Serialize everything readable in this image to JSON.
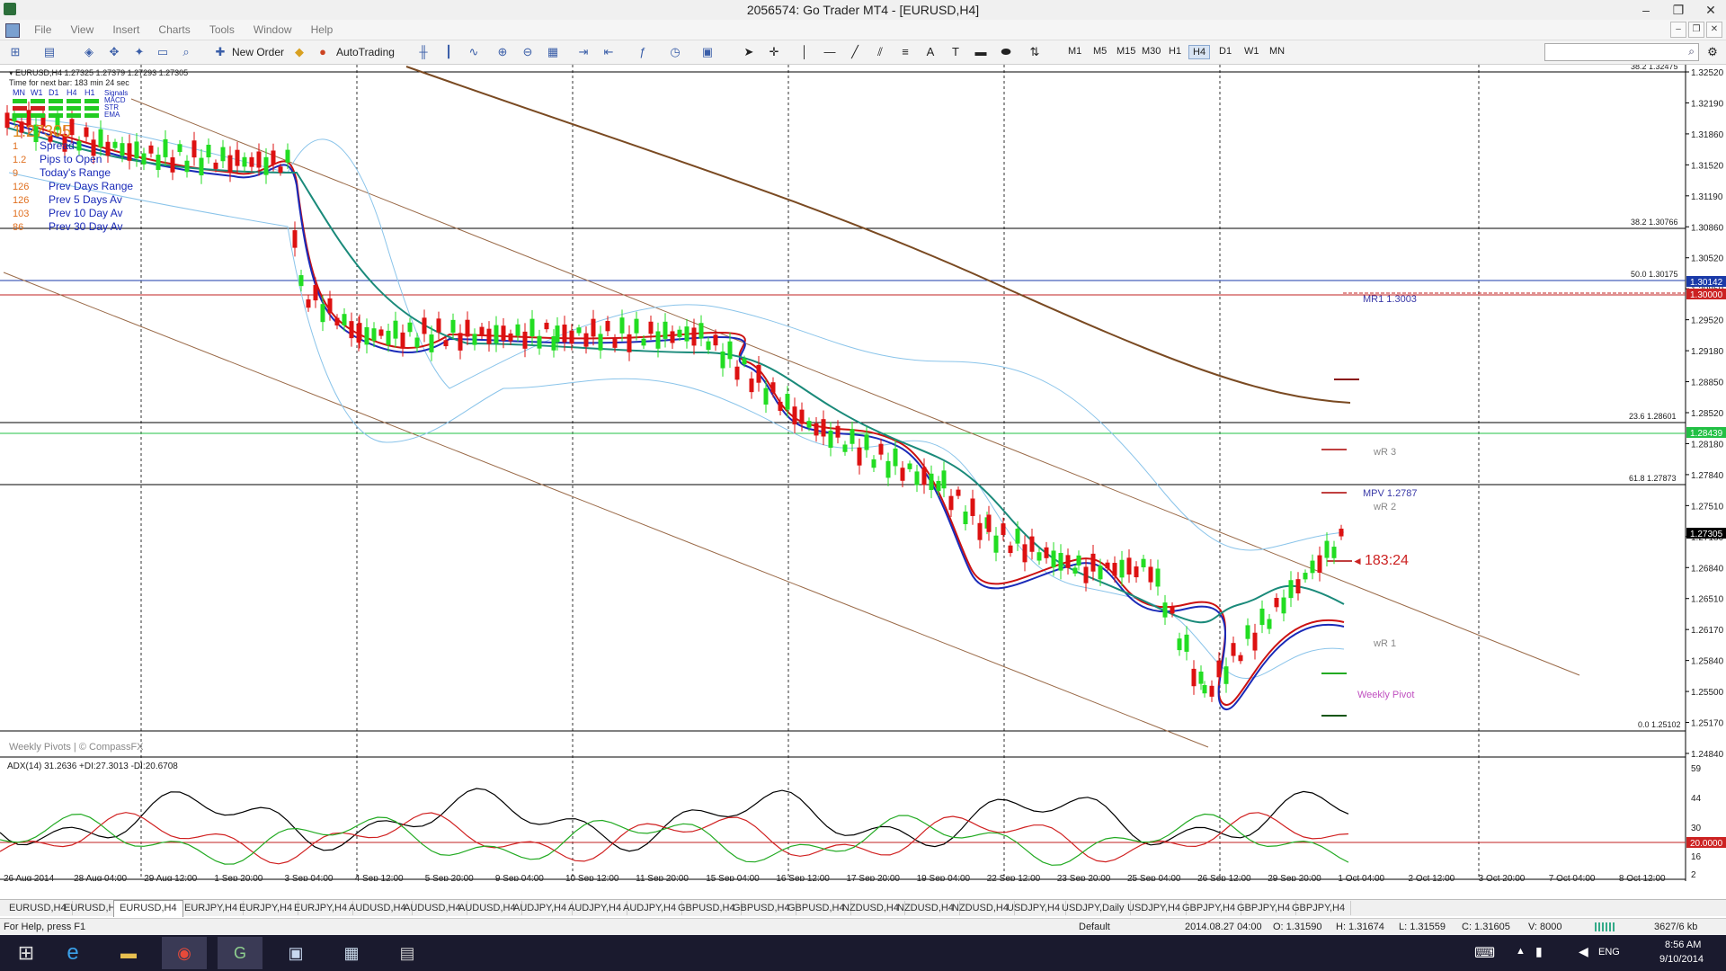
{
  "window": {
    "title": "2056574: Go Trader MT4 - [EURUSD,H4]"
  },
  "menu": [
    "File",
    "View",
    "Insert",
    "Charts",
    "Tools",
    "Window",
    "Help"
  ],
  "toolbar": {
    "new_order": "New Order",
    "auto_trading": "AutoTrading",
    "timeframes": [
      "M1",
      "M5",
      "M15",
      "M30",
      "H1",
      "H4",
      "D1",
      "W1",
      "MN"
    ],
    "active_timeframe": "H4"
  },
  "chart": {
    "header": "EURUSD,H4 1.27325 1.27379 1.27293 1.27305",
    "time_next_bar": "Time for next bar: 183 min 24 sec",
    "signal_tfs": [
      "MN",
      "W1",
      "D1",
      "H4",
      "H1"
    ],
    "signal_labels": [
      "Signals",
      "MACD",
      "STR",
      "EMA"
    ],
    "big_price": "1.27305",
    "info_rows": [
      {
        "value": "1",
        "label": "Spread"
      },
      {
        "value": "1.2",
        "label": "Pips to Open"
      },
      {
        "value": "9",
        "label": "Today's Range"
      },
      {
        "value": "126",
        "label": "Prev Days Range"
      },
      {
        "value": "126",
        "label": "Prev 5 Days Av"
      },
      {
        "value": "103",
        "label": "Prev 10 Day Av"
      },
      {
        "value": "86",
        "label": "Prev 30 Day Av"
      }
    ],
    "footer_label": "Weekly Pivots | © CompassFX",
    "countdown": "183:24",
    "fib_labels": [
      "38.2 1.30766",
      "50.0 1.30175",
      "23.6 1.28601",
      "61.8 1.27873",
      "0.0 1.25102",
      "38.2 1.32475"
    ],
    "pivot_labels": [
      "MR1 1.3003",
      "wR 3",
      "MPV 1.2787",
      "wR 2",
      "wR 1",
      "Weekly Pivot"
    ],
    "price_axis": [
      "1.32520",
      "1.32190",
      "1.31860",
      "1.31520",
      "1.31190",
      "1.30860",
      "1.30520",
      "1.29850",
      "1.29520",
      "1.29180",
      "1.28850",
      "1.28520",
      "1.28180",
      "1.27840",
      "1.27510",
      "1.27180",
      "1.26840",
      "1.26510",
      "1.26170",
      "1.25840",
      "1.25500",
      "1.25170",
      "1.24840"
    ],
    "price_tags": [
      {
        "text": "1.30142",
        "color": "#1a3aa8"
      },
      {
        "text": "1.30000",
        "color": "#cc2222"
      },
      {
        "text": "1.28439",
        "color": "#22c044"
      },
      {
        "text": "1.27305",
        "color": "#000000"
      }
    ],
    "time_axis": [
      "26 Aug 2014",
      "28 Aug 04:00",
      "29 Aug 12:00",
      "1 Sep 20:00",
      "3 Sep 04:00",
      "4 Sep 12:00",
      "5 Sep 20:00",
      "9 Sep 04:00",
      "10 Sep 12:00",
      "11 Sep 20:00",
      "15 Sep 04:00",
      "16 Sep 12:00",
      "17 Sep 20:00",
      "19 Sep 04:00",
      "22 Sep 12:00",
      "23 Sep 20:00",
      "25 Sep 04:00",
      "26 Sep 12:00",
      "29 Sep 20:00",
      "1 Oct 04:00",
      "2 Oct 12:00",
      "3 Oct 20:00",
      "7 Oct 04:00",
      "8 Oct 12:00"
    ],
    "adx_label": "ADX(14) 31.2636 +DI:27.3013 -DI:20.6708",
    "adx_axis": [
      "59",
      "44",
      "30",
      "16",
      "2"
    ],
    "adx_level": "20.0000"
  },
  "tabs": [
    "EURUSD,H4",
    "EURUSD,H4",
    "EURUSD,H4",
    "EURJPY,H4",
    "EURJPY,H4",
    "EURJPY,H4",
    "AUDUSD,H4",
    "AUDUSD,H4",
    "AUDUSD,H4",
    "AUDJPY,H4",
    "AUDJPY,H4",
    "AUDJPY,H4",
    "GBPUSD,H4",
    "GBPUSD,H4",
    "GBPUSD,H4",
    "NZDUSD,H4",
    "NZDUSD,H4",
    "NZDUSD,H4",
    "USDJPY,H4",
    "USDJPY,Daily",
    "USDJPY,H4",
    "GBPJPY,H4",
    "GBPJPY,H4",
    "GBPJPY,H4"
  ],
  "active_tab_index": 2,
  "status": {
    "help": "For Help, press F1",
    "profile": "Default",
    "datetime": "2014.08.27 04:00",
    "open": "O: 1.31590",
    "high": "H: 1.31674",
    "low": "L: 1.31559",
    "close": "C: 1.31605",
    "volume": "V: 8000",
    "traffic": "3627/6 kb"
  },
  "taskbar": {
    "lang": "ENG",
    "time": "8:56 AM",
    "date": "9/10/2014"
  }
}
